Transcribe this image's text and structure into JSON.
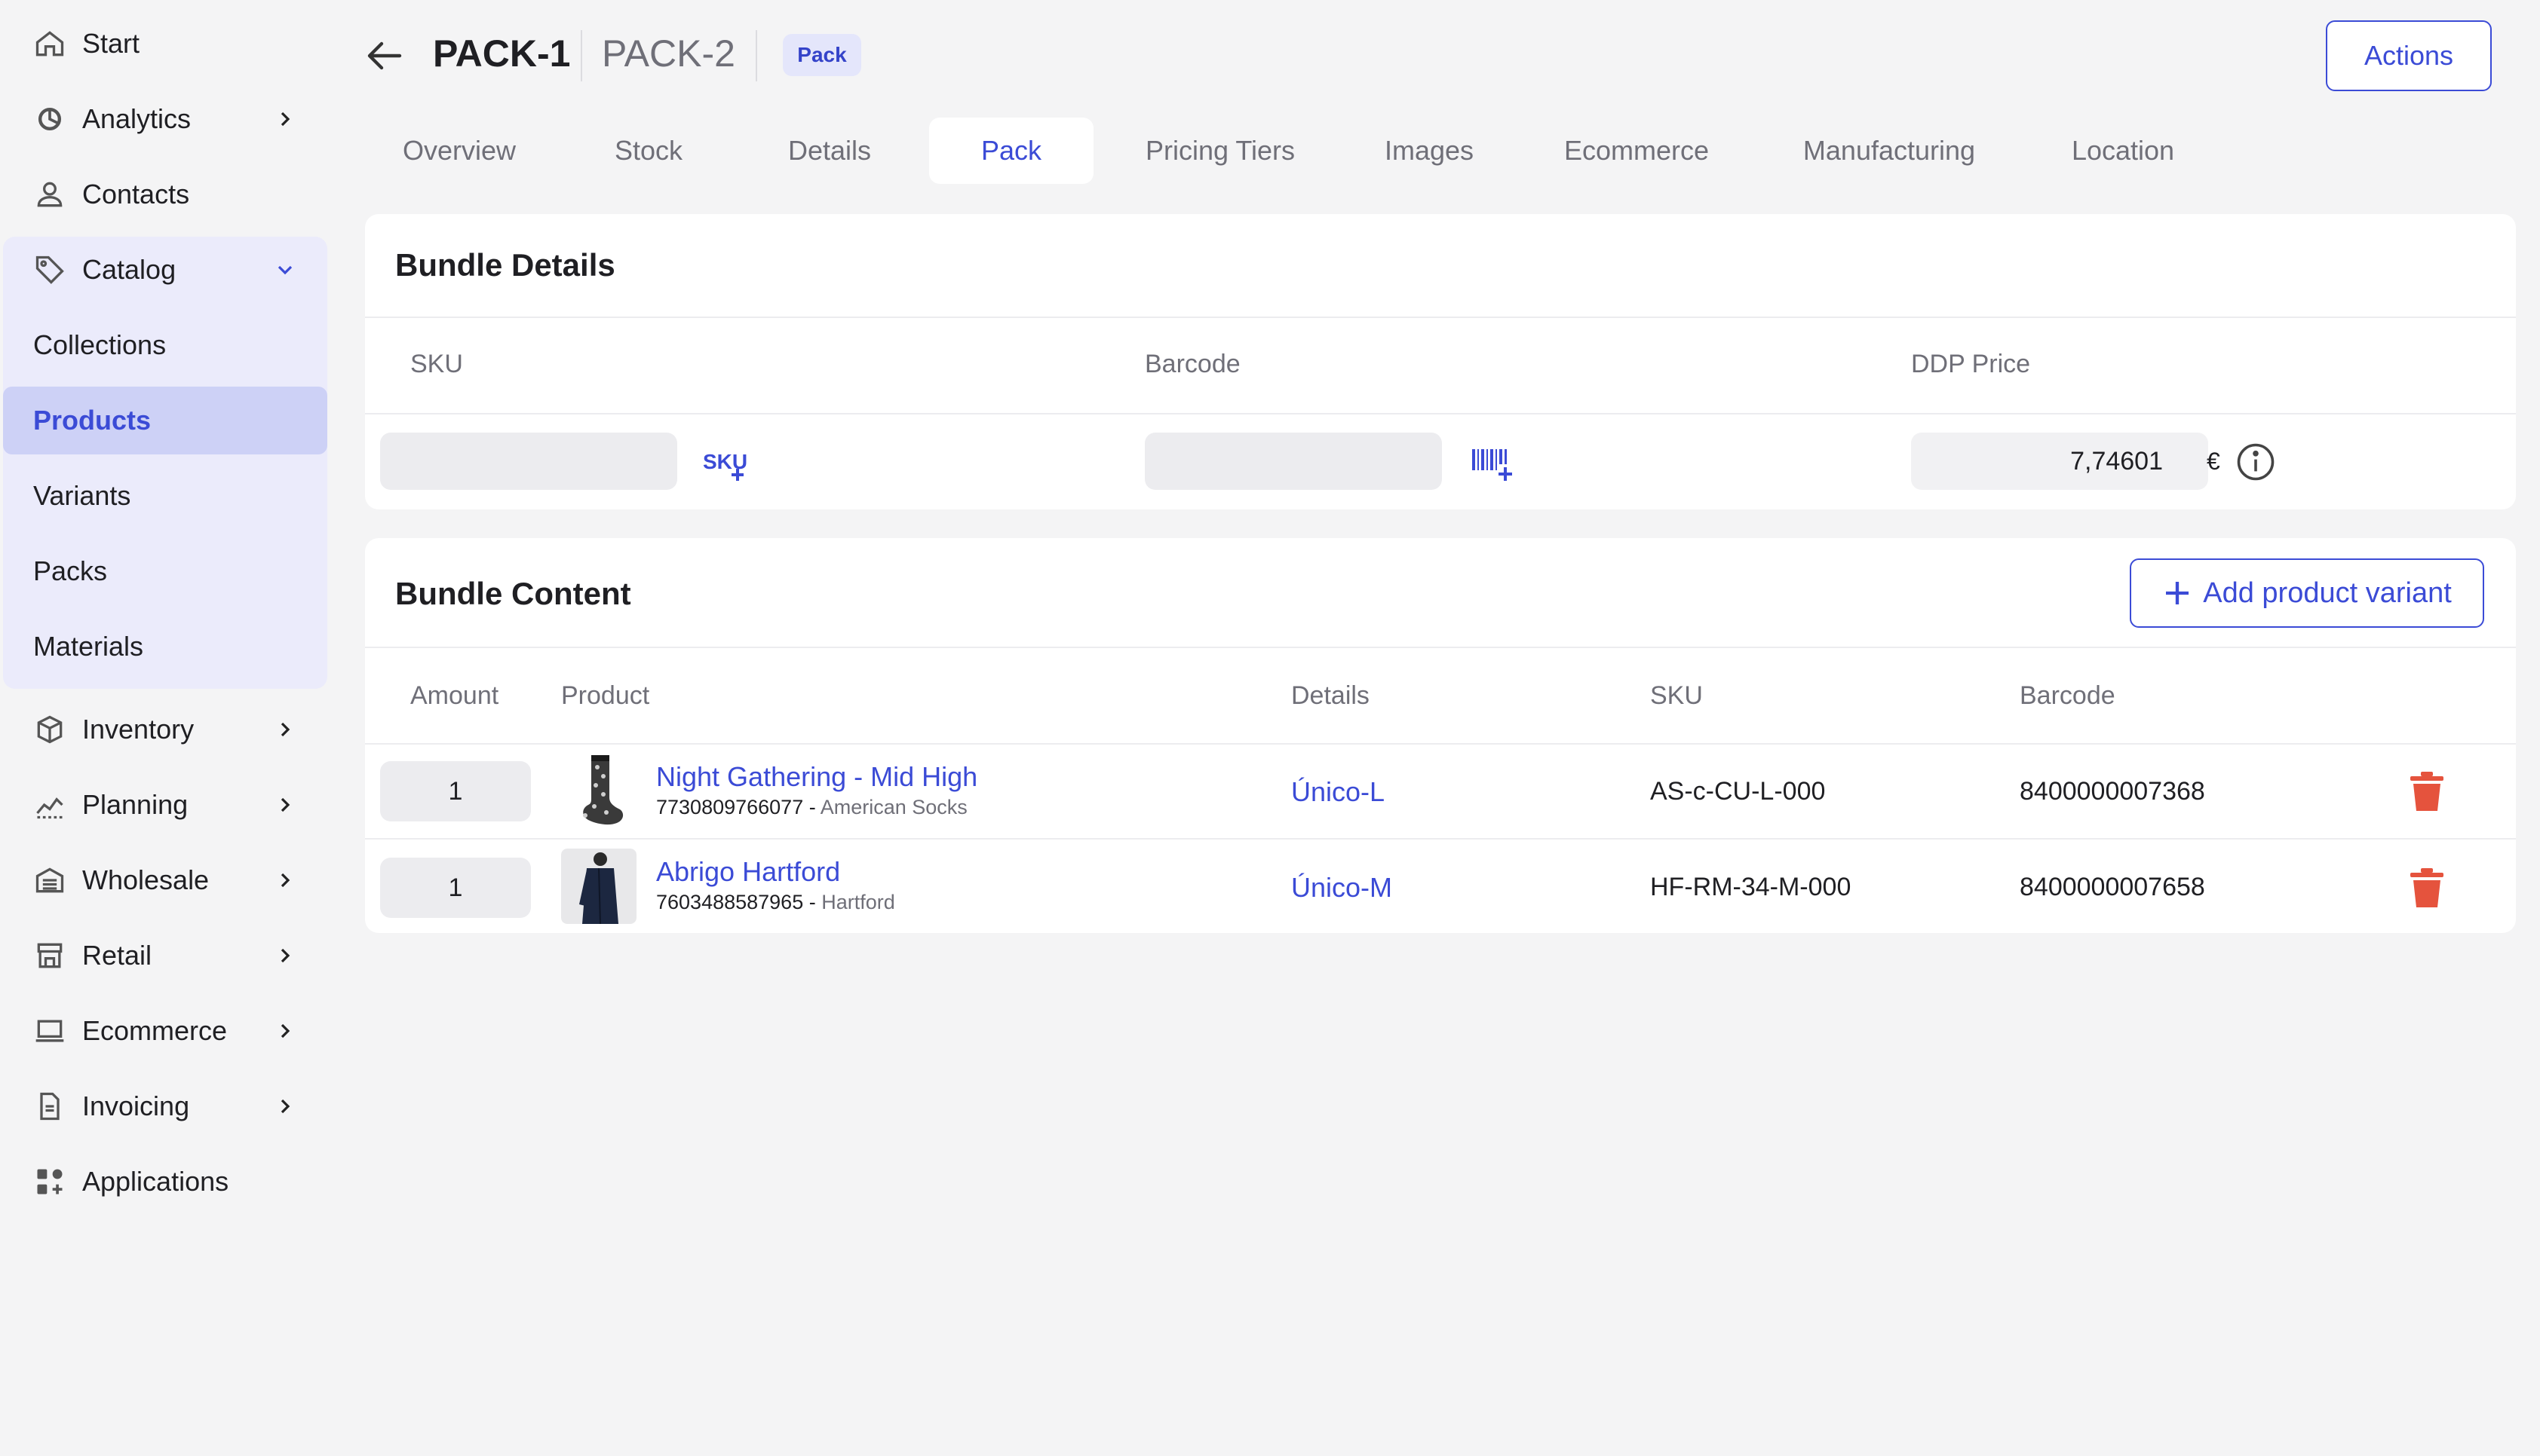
{
  "sidebar": {
    "start": "Start",
    "analytics": "Analytics",
    "contacts": "Contacts",
    "catalog": "Catalog",
    "catalog_items": [
      "Collections",
      "Products",
      "Variants",
      "Packs",
      "Materials"
    ],
    "inventory": "Inventory",
    "planning": "Planning",
    "wholesale": "Wholesale",
    "retail": "Retail",
    "ecommerce": "Ecommerce",
    "invoicing": "Invoicing",
    "applications": "Applications"
  },
  "header": {
    "title": "PACK-1",
    "subtitle": "PACK-2",
    "badge": "Pack",
    "actions": "Actions"
  },
  "tabs": [
    "Overview",
    "Stock",
    "Details",
    "Pack",
    "Pricing Tiers",
    "Images",
    "Ecommerce",
    "Manufacturing",
    "Location"
  ],
  "active_tab": "Pack",
  "bundle_details": {
    "title": "Bundle Details",
    "col_sku": "SKU",
    "col_barcode": "Barcode",
    "col_price": "DDP Price",
    "sku_value": "",
    "barcode_value": "",
    "price_value": "7,74601",
    "currency": "€"
  },
  "bundle_content": {
    "title": "Bundle Content",
    "add_button": "Add product variant",
    "columns": [
      "Amount",
      "Product",
      "Details",
      "SKU",
      "Barcode"
    ],
    "rows": [
      {
        "amount": "1",
        "name": "Night Gathering - Mid High",
        "code": "7730809766077",
        "brand": "American Socks",
        "details": "Único-L",
        "sku": "AS-c-CU-L-000",
        "barcode": "8400000007368"
      },
      {
        "amount": "1",
        "name": "Abrigo Hartford",
        "code": "7603488587965",
        "brand": "Hartford",
        "details": "Único-M",
        "sku": "HF-RM-34-M-000",
        "barcode": "8400000007658"
      }
    ]
  },
  "colors": {
    "accent": "#3b4bd6",
    "danger": "#e5533d",
    "sidebar_group_bg": "#ebebfb",
    "active_bg": "#cdd1f6"
  }
}
